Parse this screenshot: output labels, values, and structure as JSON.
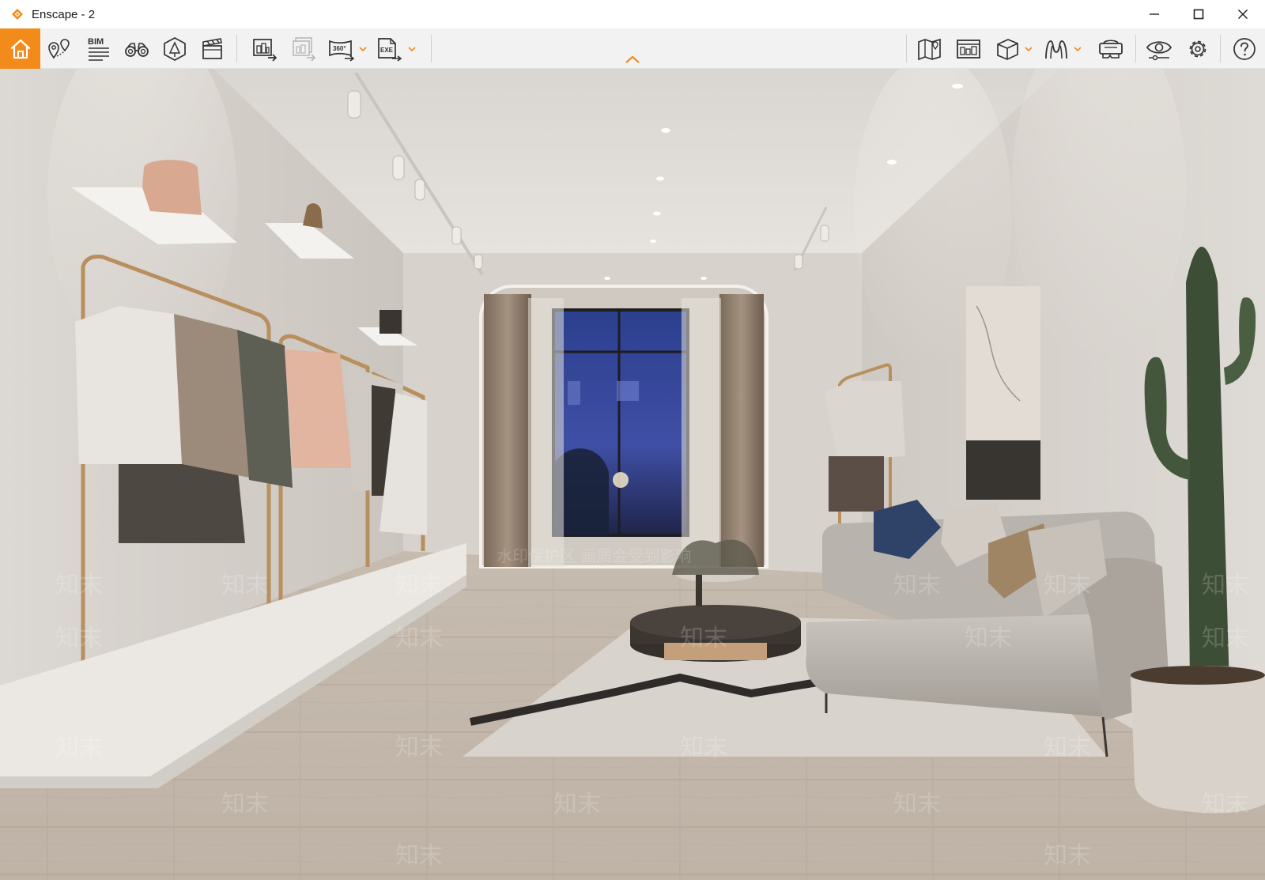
{
  "window": {
    "title": "Enscape - 2",
    "controls": [
      "minimize-icon",
      "maximize-icon",
      "close-icon"
    ]
  },
  "toolbar": {
    "accent_color": "#f38b1b",
    "left_tools": [
      {
        "name": "home",
        "icon": "home-icon"
      },
      {
        "name": "location-markers",
        "icon": "map-pin-icon"
      },
      {
        "name": "bim-info",
        "icon": "bim-icon",
        "label": "BIM"
      },
      {
        "name": "views",
        "icon": "binoculars-icon"
      },
      {
        "name": "asset-library",
        "icon": "asset-library-icon"
      },
      {
        "name": "video-editor",
        "icon": "clapperboard-icon"
      },
      {
        "name": "render-image",
        "icon": "render-image-icon"
      },
      {
        "name": "batch-render",
        "icon": "batch-render-icon"
      },
      {
        "name": "render-panorama",
        "icon": "panorama-icon",
        "label": "360°"
      },
      {
        "name": "export-exe",
        "icon": "exe-export-icon",
        "label": "EXE"
      }
    ],
    "right_tools": [
      {
        "name": "minimap",
        "icon": "map-icon"
      },
      {
        "name": "manage-uploads",
        "icon": "uploads-icon"
      },
      {
        "name": "cube-view",
        "icon": "cube-icon"
      },
      {
        "name": "mode-switch",
        "icon": "walk-icon"
      },
      {
        "name": "vr-headset",
        "icon": "vr-headset-icon"
      },
      {
        "name": "visual-settings",
        "icon": "eye-settings-icon"
      },
      {
        "name": "settings",
        "icon": "gear-icon"
      },
      {
        "name": "help",
        "icon": "help-icon"
      }
    ]
  },
  "viewport": {
    "scene": "interior-render-boutique-living-room",
    "watermark_text": "知末",
    "watermark_banner": "水印保护区  画质会受到影响"
  }
}
